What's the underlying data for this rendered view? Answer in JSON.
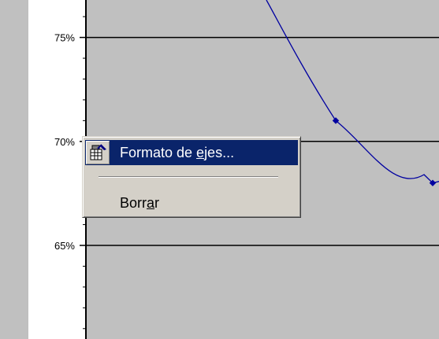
{
  "chart_data": {
    "type": "line",
    "y_ticks": [
      "75%",
      "70%",
      "65%"
    ],
    "y_tick_values": [
      75,
      70,
      65
    ],
    "ylim": [
      60.5,
      76.8
    ],
    "series": [
      {
        "points": [
          {
            "x": 3.0,
            "y": 77.0
          },
          {
            "x": 4.0,
            "y": 71.0
          },
          {
            "x": 5.0,
            "y": 68.0
          }
        ]
      }
    ],
    "line_color": "#0000a0",
    "plot_background": "#c0c0c0",
    "gridlines": "horizontal, major ticks only"
  },
  "context_menu": {
    "items": [
      {
        "label_before": "Formato de ",
        "label_mnemonic": "e",
        "label_after": "jes...",
        "icon": "format-axis-icon",
        "highlighted": true
      },
      {
        "label_before": "Borr",
        "label_mnemonic": "a",
        "label_after": "r",
        "icon": "",
        "highlighted": false
      }
    ]
  },
  "colors": {
    "highlight": "#0a246a",
    "menu_face": "#d4d0c8",
    "left_panel": "#c0c0c0"
  }
}
